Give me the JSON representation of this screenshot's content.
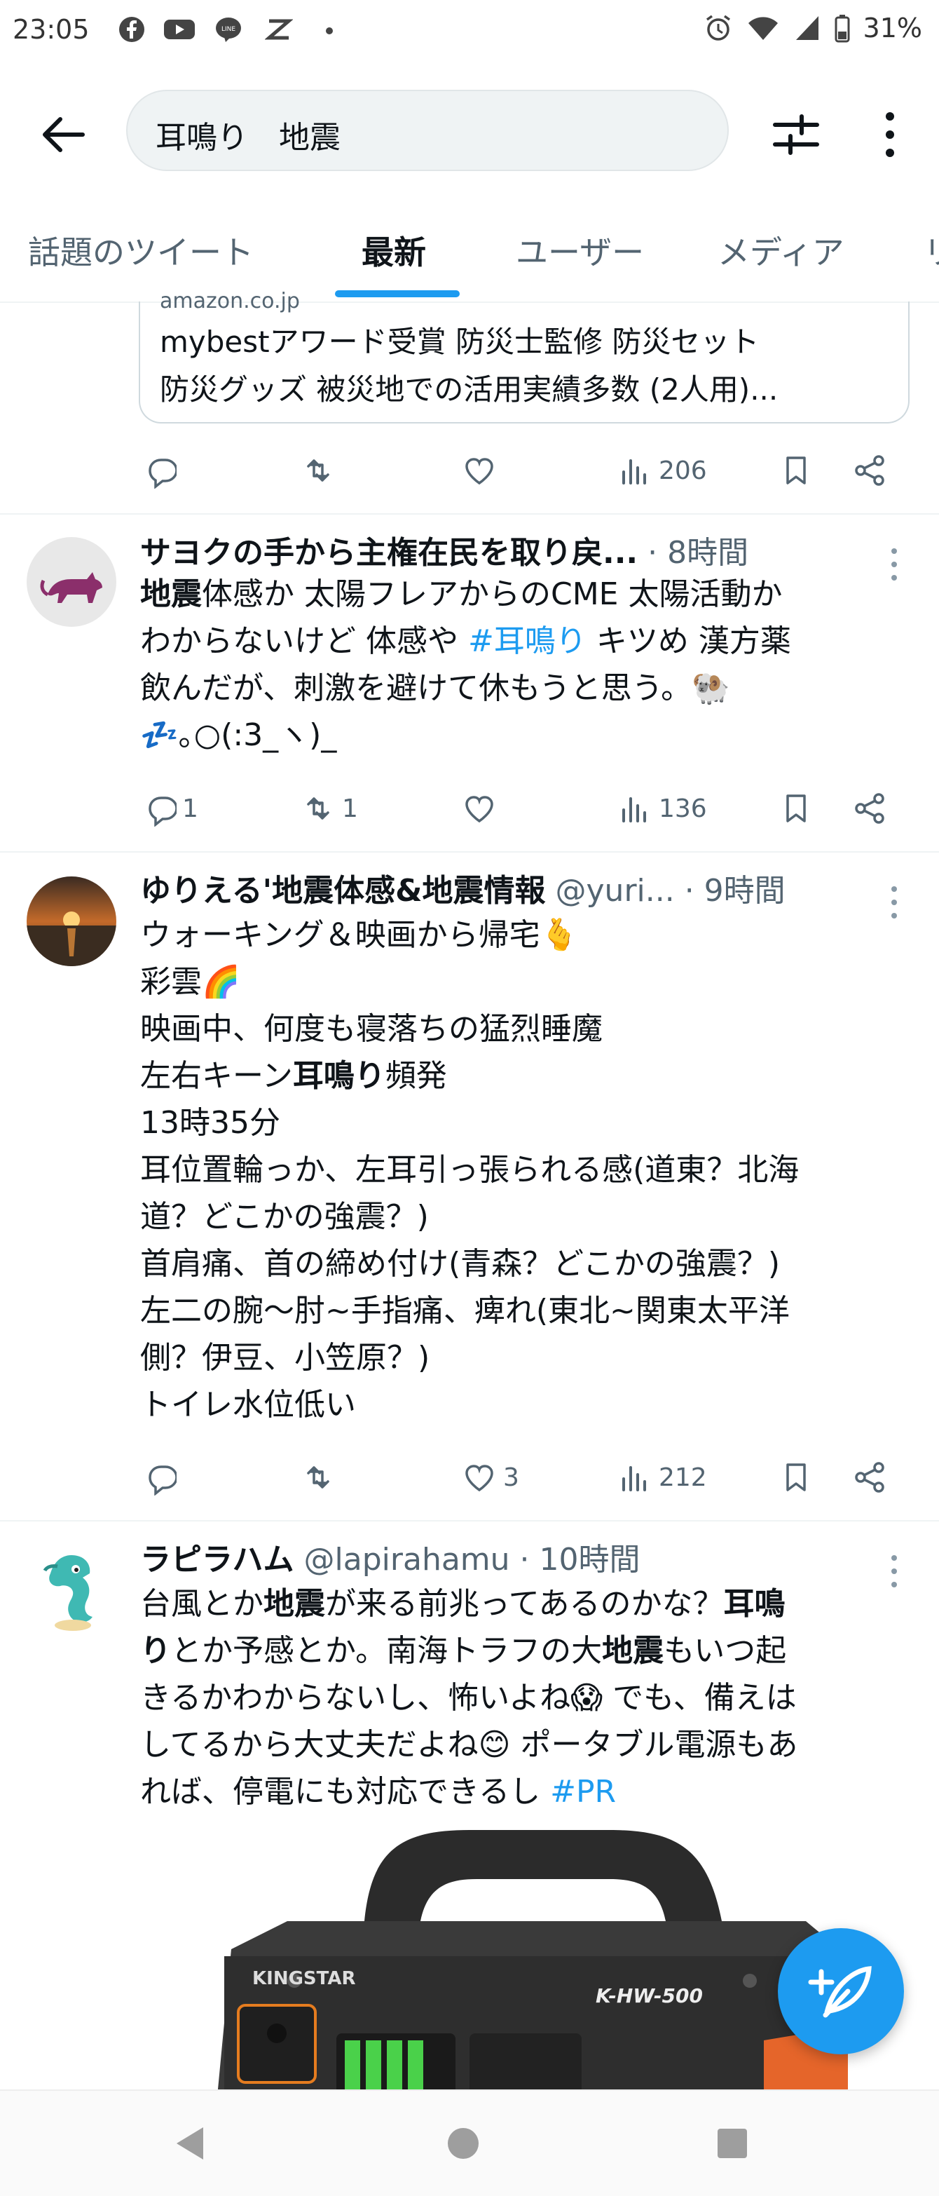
{
  "status_bar": {
    "time": "23:05",
    "battery": "31%"
  },
  "search": {
    "query": "耳鳴り　地震"
  },
  "tabs": [
    {
      "label": "話題のツイート"
    },
    {
      "label": "最新",
      "active": true
    },
    {
      "label": "ユーザー"
    },
    {
      "label": "メディア"
    },
    {
      "label": "リ"
    }
  ],
  "card": {
    "url_partial": "amazon.co.jp",
    "line1": "mybestアワード受賞 防災士監修 防災セット",
    "line2": "防災グッズ 被災地での活用実績多数 (2人用)..."
  },
  "tweets": [
    {
      "name": "サヨクの手から主権在民を取り戻...",
      "meta": " · 8時間",
      "body_lines": [
        [
          {
            "t": "地震",
            "b": true
          },
          {
            "t": "体感か 太陽フレアからのCME 太陽活動か"
          }
        ],
        [
          {
            "t": "わからないけど 体感や "
          },
          {
            "t": "#耳鳴り",
            "h": true
          },
          {
            "t": " キツめ 漢方薬"
          }
        ],
        [
          {
            "t": "飲んだが、刺激を避けて休もうと思う。🐏"
          }
        ],
        [
          {
            "t": "💤｡○(:3_ヽ)_"
          }
        ]
      ],
      "replies": "1",
      "retweets": "1",
      "likes": "",
      "views": "136"
    },
    {
      "name": "ゆりえる'地震体感&地震情報",
      "meta": " @yuri... · 9時間",
      "body_lines": [
        [
          {
            "t": "ウォーキング＆映画から帰宅🫰"
          }
        ],
        [
          {
            "t": "彩雲🌈"
          }
        ],
        [
          {
            "t": "映画中、何度も寝落ちの猛烈睡魔"
          }
        ],
        [
          {
            "t": "左右キーン"
          },
          {
            "t": "耳鳴り",
            "b": true
          },
          {
            "t": "頻発"
          }
        ],
        [
          {
            "t": "13時35分"
          }
        ],
        [
          {
            "t": "耳位置輪っか、左耳引っ張られる感(道東？北海"
          }
        ],
        [
          {
            "t": "道？どこかの強震？)"
          }
        ],
        [
          {
            "t": "首肩痛、首の締め付け(青森？どこかの強震？)"
          }
        ],
        [
          {
            "t": "左二の腕〜肘~手指痛、痺れ(東北~関東太平洋"
          }
        ],
        [
          {
            "t": "側？伊豆、小笠原？)"
          }
        ],
        [
          {
            "t": "トイレ水位低い"
          }
        ]
      ],
      "replies": "",
      "retweets": "",
      "likes": "3",
      "views": "212"
    },
    {
      "name": "ラピラハム",
      "meta": " @lapirahamu · 10時間",
      "body_lines": [
        [
          {
            "t": "台風とか"
          },
          {
            "t": "地震",
            "b": true
          },
          {
            "t": "が来る前兆ってあるのかな？"
          },
          {
            "t": "耳鳴",
            "b": true
          }
        ],
        [
          {
            "t": "り",
            "b": true
          },
          {
            "t": "とか予感とか。南海トラフの大"
          },
          {
            "t": "地震",
            "b": true
          },
          {
            "t": "もいつ起"
          }
        ],
        [
          {
            "t": "きるかわからないし、怖いよね😱 でも、備えは"
          }
        ],
        [
          {
            "t": "してるから大丈夫だよね😊 ポータブル電源もあ"
          }
        ],
        [
          {
            "t": "れば、停電にも対応できるし "
          },
          {
            "t": "#PR",
            "h": true
          }
        ]
      ],
      "product": {
        "brand": "KINGSTAR",
        "model": "K-HW-500"
      }
    }
  ],
  "first_actions": {
    "replies": "",
    "retweets": "",
    "likes": "",
    "views": "206"
  },
  "colors": {
    "accent": "#1d9bf0",
    "text": "#0f1419",
    "muted": "#536471"
  }
}
